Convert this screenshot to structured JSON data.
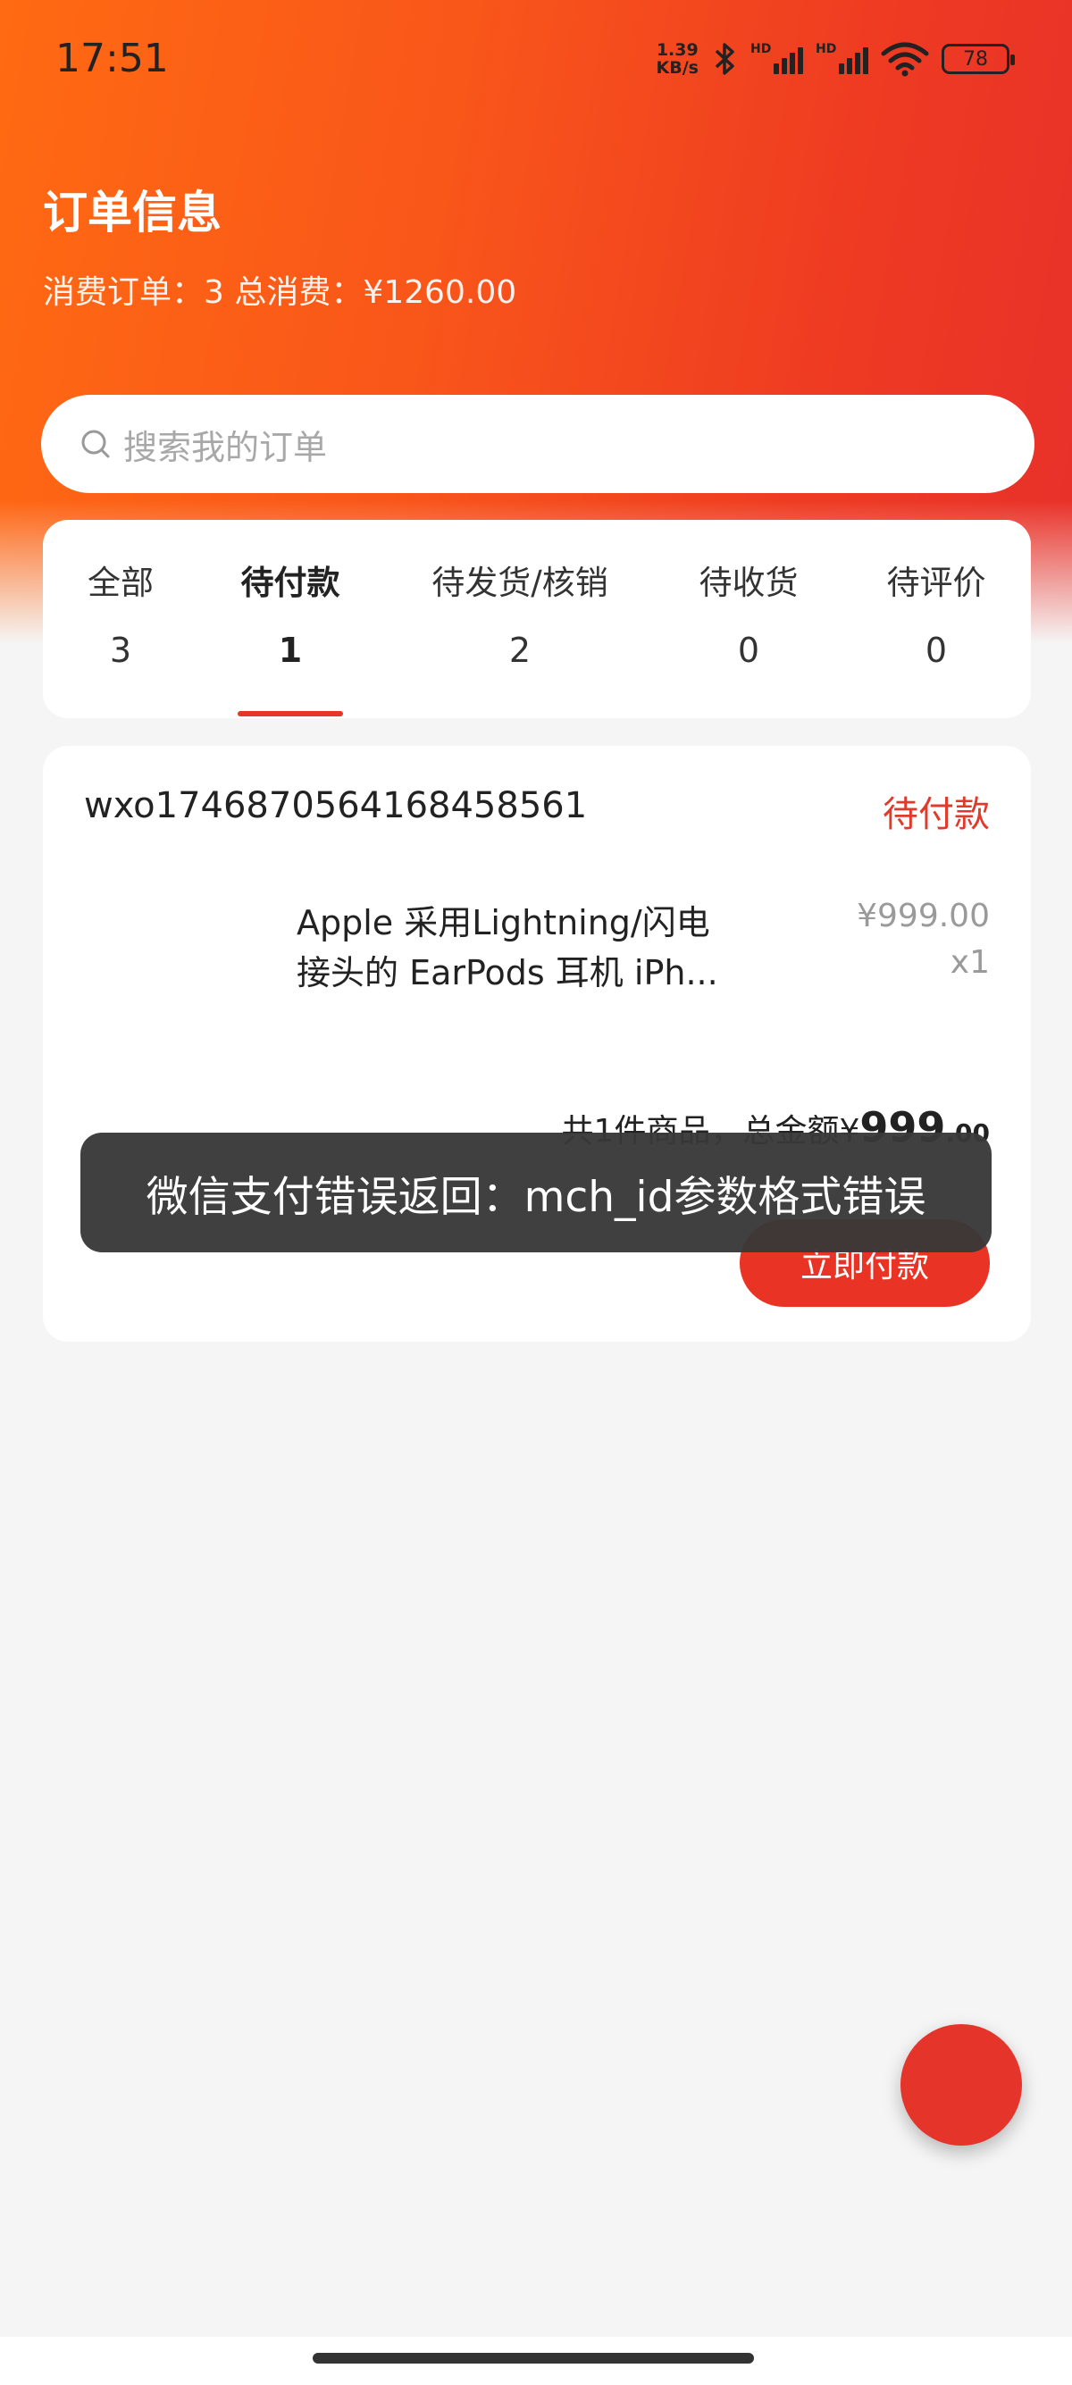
{
  "status_bar": {
    "time": "17:51",
    "net_speed_value": "1.39",
    "net_speed_unit": "KB/s",
    "signal1_label": "HD",
    "signal2_label": "HD",
    "battery": "78"
  },
  "header": {
    "title": "订单信息",
    "summary": "消费订单：3 总消费：¥1260.00"
  },
  "search": {
    "placeholder": "搜索我的订单"
  },
  "tabs": [
    {
      "label": "全部",
      "count": "3"
    },
    {
      "label": "待付款",
      "count": "1"
    },
    {
      "label": "待发货/核销",
      "count": "2"
    },
    {
      "label": "待收货",
      "count": "0"
    },
    {
      "label": "待评价",
      "count": "0"
    }
  ],
  "active_tab": "待付款",
  "order": {
    "order_no": "wxo1746870564168458561",
    "status": "待付款",
    "product_name_line1": "Apple 采用Lightning/闪电",
    "product_name_line2": "接头的 EarPods 耳机 iPh...",
    "price": "¥999.00",
    "quantity": "x1",
    "total_prefix": "共1件商品，总金额¥",
    "total_int": "999",
    "total_dec": ".00",
    "pay_button": "立即付款"
  },
  "toast": {
    "message": "微信支付错误返回：mch_id参数格式错误"
  },
  "colors": {
    "accent": "#e8352a",
    "header_gradient_start": "#ff6a12",
    "header_gradient_end": "#e8302a"
  }
}
